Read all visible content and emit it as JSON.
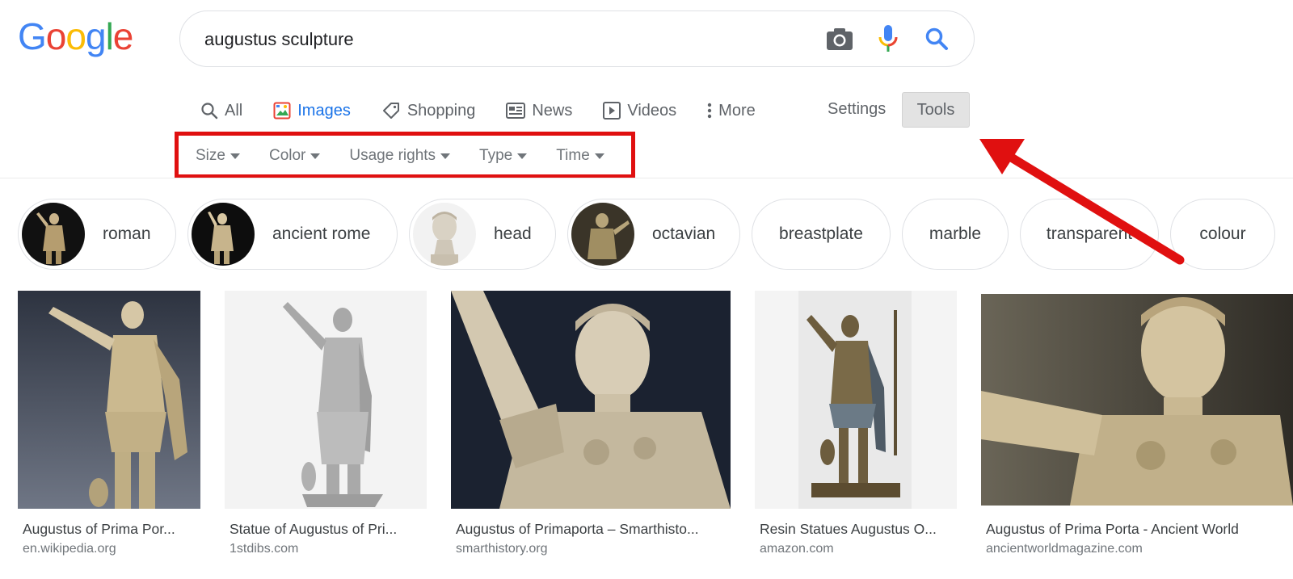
{
  "logo": {
    "letters": [
      "G",
      "o",
      "o",
      "g",
      "l",
      "e"
    ],
    "colors": [
      "#4285f4",
      "#ea4335",
      "#fbbc05",
      "#4285f4",
      "#34a853",
      "#ea4335"
    ]
  },
  "search": {
    "query": "augustus sculpture",
    "icons": [
      "camera-icon",
      "microphone-icon",
      "search-icon"
    ]
  },
  "tabs": [
    {
      "label": "All",
      "icon": "search-icon",
      "active": false
    },
    {
      "label": "Images",
      "icon": "image-icon",
      "active": true
    },
    {
      "label": "Shopping",
      "icon": "tag-icon",
      "active": false
    },
    {
      "label": "News",
      "icon": "news-icon",
      "active": false
    },
    {
      "label": "Videos",
      "icon": "video-icon",
      "active": false
    },
    {
      "label": "More",
      "icon": "more-vert-icon",
      "active": false
    }
  ],
  "settings_label": "Settings",
  "tools_label": "Tools",
  "filters": [
    "Size",
    "Color",
    "Usage rights",
    "Type",
    "Time"
  ],
  "chips": [
    {
      "label": "roman",
      "has_thumb": true
    },
    {
      "label": "ancient rome",
      "has_thumb": true
    },
    {
      "label": "head",
      "has_thumb": true
    },
    {
      "label": "octavian",
      "has_thumb": true
    },
    {
      "label": "breastplate",
      "has_thumb": false
    },
    {
      "label": "marble",
      "has_thumb": false
    },
    {
      "label": "transparent",
      "has_thumb": false
    },
    {
      "label": "colour",
      "has_thumb": false
    }
  ],
  "results": [
    {
      "title": "Augustus of Prima Por...",
      "domain": "en.wikipedia.org"
    },
    {
      "title": "Statue of Augustus of Pri...",
      "domain": "1stdibs.com"
    },
    {
      "title": "Augustus of Primaporta – Smarthisto...",
      "domain": "smarthistory.org"
    },
    {
      "title": "Resin Statues Augustus O...",
      "domain": "amazon.com"
    },
    {
      "title": "Augustus of Prima Porta - Ancient World",
      "domain": "ancientworldmagazine.com"
    }
  ],
  "colors": {
    "accent_blue": "#1a73e8",
    "annotation_red": "#e01010",
    "text_gray": "#5f6368"
  }
}
